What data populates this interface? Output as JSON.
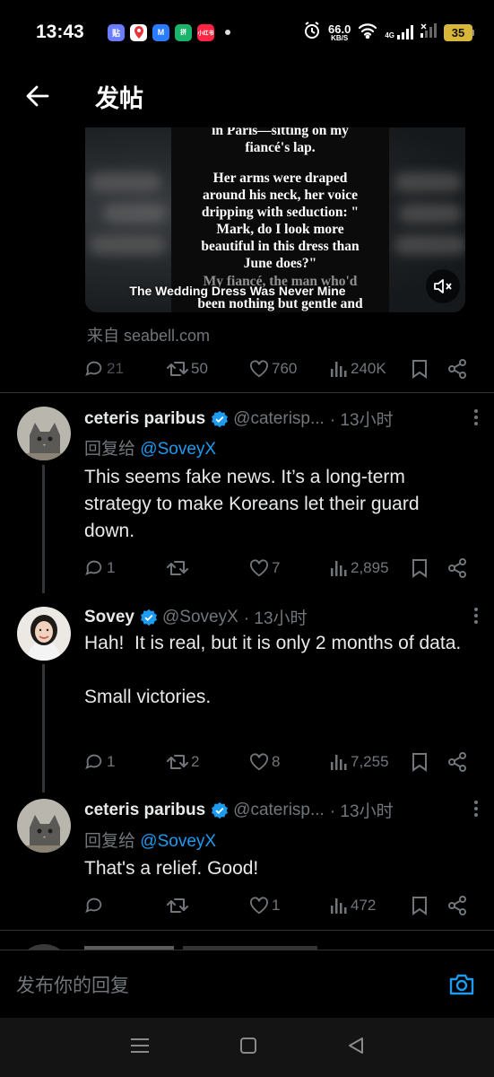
{
  "status_bar": {
    "time": "13:43",
    "apps": [
      {
        "icon": "app-icon-blue",
        "label": "贴",
        "color": "#6c7cff"
      },
      {
        "icon": "map-pin-icon",
        "label": "",
        "color": "#ffffff"
      },
      {
        "icon": "app-icon-m",
        "label": "M",
        "color": "#2b7bff"
      },
      {
        "icon": "app-icon-green",
        "label": "拼",
        "color": "#1bb36b"
      },
      {
        "icon": "app-icon-red",
        "label": "小红书",
        "color": "#ff2442"
      }
    ],
    "net_speed_value": "66.0",
    "net_speed_unit": "KB/S",
    "network_type": "4G",
    "battery": "35"
  },
  "header": {
    "title": "发帖",
    "back_icon": "arrow-left-icon"
  },
  "media": {
    "text_lines": [
      "in Paris—sitting on my",
      "fiancé's lap.",
      "",
      "Her arms were draped",
      "around his neck, her voice",
      "dripping with seduction: \"",
      "Mark, do I look more",
      "beautiful in this dress than",
      "June does?\"",
      "",
      "My fiancé, the man who'd",
      "been nothing but gentle and"
    ],
    "caption": "The Wedding Dress Was Never Mine",
    "mute_icon": "volume-muted-icon"
  },
  "source": "来自 seabell.com",
  "main_actions": {
    "replies": "21",
    "reposts": "50",
    "likes": "760",
    "views": "240K"
  },
  "replies": [
    {
      "name": "ceteris paribus",
      "handle": "@caterisp...",
      "time": "· 13小时",
      "reply_prefix": "回复给",
      "reply_mention": "@SoveyX",
      "text": "This seems fake news. It’s a long-term strategy to make Koreans let their guard down.",
      "replies": "1",
      "reposts": "",
      "likes": "7",
      "views": "2,895"
    },
    {
      "name": "Sovey",
      "handle": "@SoveyX",
      "time": "· 13小时",
      "text": "Hah!  It is real, but it is only 2 months of data.\n\nSmall victories.",
      "replies": "1",
      "reposts": "2",
      "likes": "8",
      "views": "7,255"
    },
    {
      "name": "ceteris paribus",
      "handle": "@caterisp...",
      "time": "· 13小时",
      "reply_prefix": "回复给",
      "reply_mention": "@SoveyX",
      "text": "That's a relief. Good!",
      "replies": "",
      "reposts": "",
      "likes": "1",
      "views": "472"
    }
  ],
  "compose": {
    "placeholder": "发布你的回复"
  },
  "colors": {
    "accent": "#1d9bf0",
    "muted": "#71767b",
    "text": "#e7e9ea",
    "background": "#000000"
  }
}
